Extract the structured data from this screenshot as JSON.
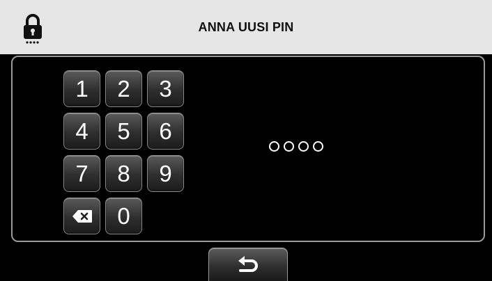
{
  "header": {
    "title": "ANNA UUSI PIN",
    "icon": "lock-icon"
  },
  "keypad": {
    "keys": [
      "1",
      "2",
      "3",
      "4",
      "5",
      "6",
      "7",
      "8",
      "9",
      "0"
    ],
    "backspace_icon": "backspace-icon"
  },
  "pin": {
    "length": 4,
    "entered": 0
  },
  "footer": {
    "back_icon": "return-arrow-icon"
  },
  "colors": {
    "header_bg": "#e6e6e6",
    "screen_bg": "#000000",
    "panel_border": "#9a9a9a",
    "key_text": "#ffffff"
  }
}
